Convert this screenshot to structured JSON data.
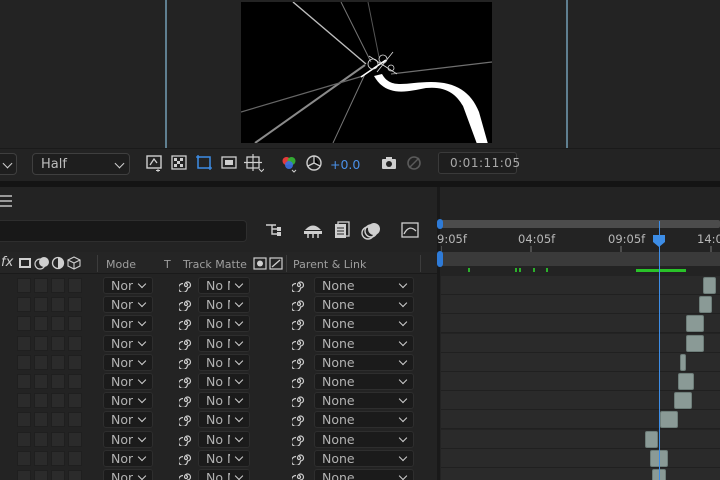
{
  "viewer": {
    "resolution": "Half",
    "exposure": "+0.0",
    "timecode": "0:01:11:05"
  },
  "timeline": {
    "ruler_labels": [
      "9:05f",
      "04:05f",
      "09:05f",
      "14:0"
    ],
    "headers": {
      "fx": "fx",
      "mode": "Mode",
      "t": "T",
      "track_matte": "Track Matte",
      "parent_link": "Parent & Link"
    },
    "rows": [
      {
        "mode": "Norm",
        "matte": "No Matte",
        "parent": "None"
      },
      {
        "mode": "Norm",
        "matte": "No Matte",
        "parent": "None"
      },
      {
        "mode": "Norm",
        "matte": "No Matte",
        "parent": "None"
      },
      {
        "mode": "Norm",
        "matte": "No Matte",
        "parent": "None"
      },
      {
        "mode": "Norm",
        "matte": "No Matte",
        "parent": "None"
      },
      {
        "mode": "Norm",
        "matte": "No Matte",
        "parent": "None"
      },
      {
        "mode": "Norm",
        "matte": "No Matte",
        "parent": "None"
      },
      {
        "mode": "Norm",
        "matte": "No Matte",
        "parent": "None"
      },
      {
        "mode": "Norm",
        "matte": "No Matte",
        "parent": "None"
      },
      {
        "mode": "Norm",
        "matte": "No Matte",
        "parent": "None"
      },
      {
        "mode": "Norm",
        "matte": "No Matte",
        "parent": "None"
      }
    ]
  },
  "icons": {
    "toolbar": [
      "snapshot-icon",
      "transparency-grid-icon",
      "region-of-interest-icon",
      "mask-visibility-icon",
      "grid-guides-icon",
      "color-channels-icon",
      "exposure-reset-icon",
      "camera-icon",
      "show-snapshot-icon"
    ],
    "timeline": [
      "hamburger-menu-icon",
      "composition-flowchart-icon",
      "draft-3d-icon",
      "frame-blending-icon",
      "motion-blur-icon",
      "graph-editor-icon"
    ]
  },
  "colors": {
    "accent": "#3d8de6",
    "markers": "#29c229",
    "clips": "#8a9a96"
  }
}
